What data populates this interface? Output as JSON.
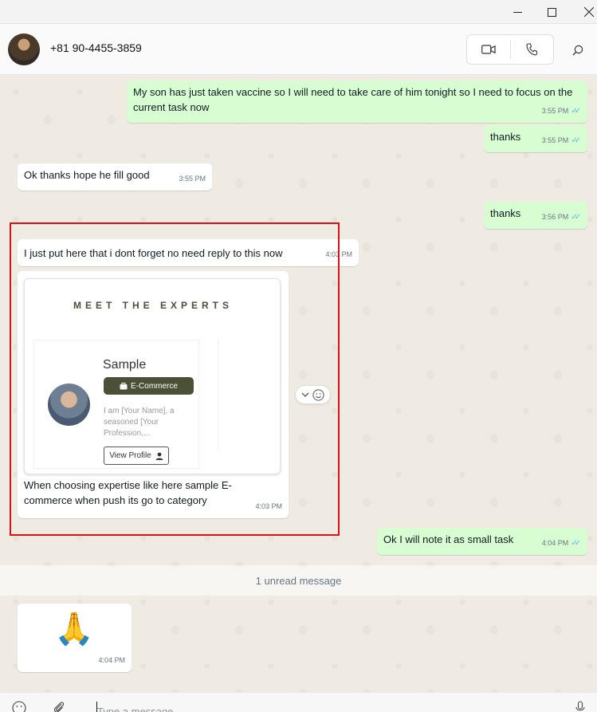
{
  "contact": {
    "name": "+81 90-4455-3859"
  },
  "messages": [
    {
      "direction": "out",
      "text": "My son has just taken vaccine so I will need to take care of him tonight so I need to focus on the current task now",
      "time": "3:55 PM"
    },
    {
      "direction": "out",
      "text": "thanks",
      "time": "3:55 PM"
    },
    {
      "direction": "in",
      "text": "Ok thanks hope he fill good",
      "time": "3:55 PM"
    },
    {
      "direction": "out",
      "text": "thanks",
      "time": "3:56 PM"
    },
    {
      "direction": "in",
      "text": "I just put here that i dont forget no need reply to this now",
      "time": "4:03 PM"
    },
    {
      "direction": "in",
      "text": "When choosing expertise like here sample E-commerce when push its go to category",
      "time": "4:03 PM"
    },
    {
      "direction": "out",
      "text": "Ok I will note it as small task",
      "time": "4:04 PM"
    },
    {
      "direction": "in",
      "text": "🙏",
      "time": "4:04 PM"
    }
  ],
  "preview_card": {
    "title": "MEET THE EXPERTS",
    "profile_name": "Sample",
    "tag": "E-Commerce",
    "description": "I am [Your Name], a seasoned [Your Profession,...",
    "button_label": "View Profile"
  },
  "unread_label": "1 unread message",
  "composer": {
    "placeholder": "Type a message"
  },
  "colors": {
    "outgoing_bubble": "#d9fdd3",
    "incoming_bubble": "#ffffff",
    "read_ticks": "#53bdeb",
    "highlight_box": "#e01010",
    "tag_bg": "#4b5137"
  },
  "icons": [
    "minimize-icon",
    "maximize-icon",
    "close-icon",
    "video-call-icon",
    "voice-call-icon",
    "search-icon",
    "chevron-down-icon",
    "emoji-icon",
    "attach-icon",
    "microphone-icon",
    "briefcase-icon",
    "user-icon"
  ]
}
